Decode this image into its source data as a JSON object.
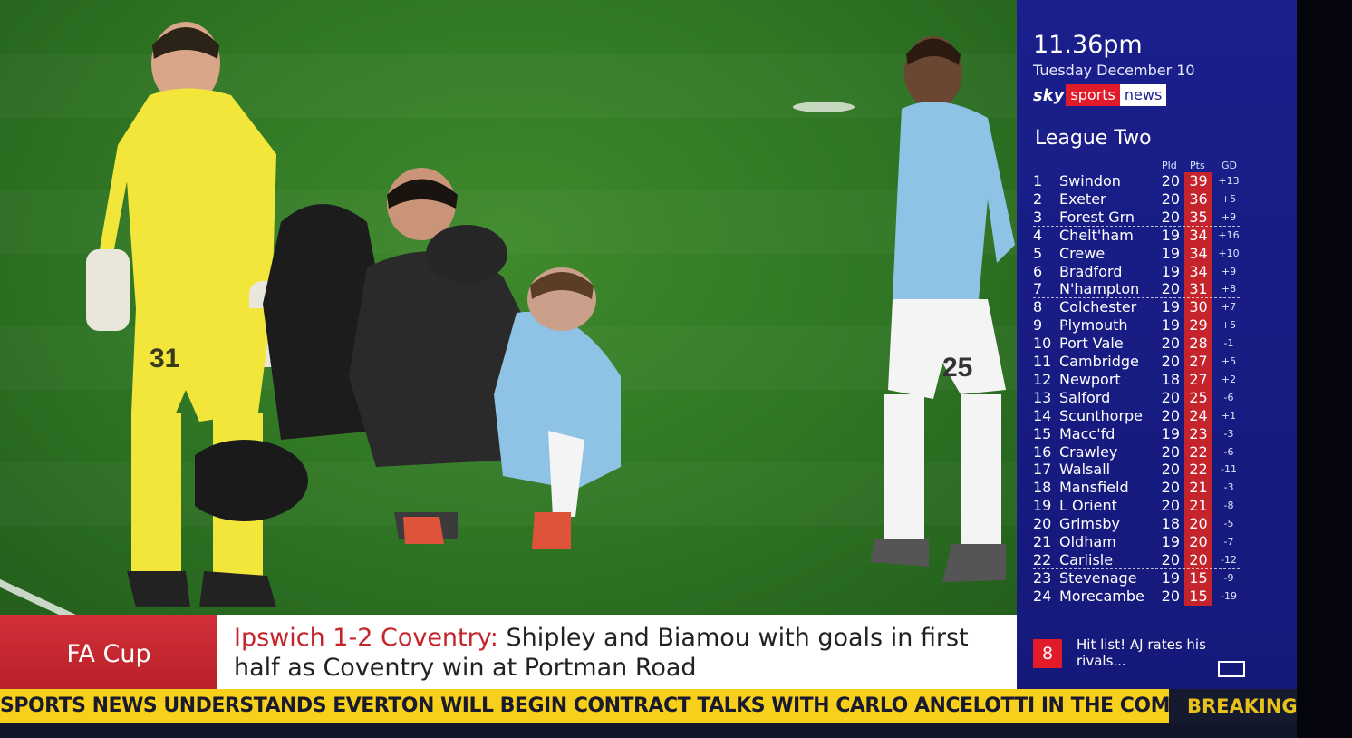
{
  "panel": {
    "time": "11.36pm",
    "date": "Tuesday December 10",
    "logo": {
      "sky": "sky",
      "sports": "sports",
      "news": "news"
    },
    "league_title": "League Two",
    "columns": {
      "pld": "Pld",
      "pts": "Pts",
      "gd": "GD"
    },
    "table": [
      {
        "pos": "1",
        "team": "Swindon",
        "pld": "20",
        "pts": "39",
        "gd": "+13"
      },
      {
        "pos": "2",
        "team": "Exeter",
        "pld": "20",
        "pts": "36",
        "gd": "+5"
      },
      {
        "pos": "3",
        "team": "Forest Grn",
        "pld": "20",
        "pts": "35",
        "gd": "+9"
      },
      {
        "pos": "4",
        "team": "Chelt'ham",
        "pld": "19",
        "pts": "34",
        "gd": "+16"
      },
      {
        "pos": "5",
        "team": "Crewe",
        "pld": "19",
        "pts": "34",
        "gd": "+10"
      },
      {
        "pos": "6",
        "team": "Bradford",
        "pld": "19",
        "pts": "34",
        "gd": "+9"
      },
      {
        "pos": "7",
        "team": "N'hampton",
        "pld": "20",
        "pts": "31",
        "gd": "+8"
      },
      {
        "pos": "8",
        "team": "Colchester",
        "pld": "19",
        "pts": "30",
        "gd": "+7"
      },
      {
        "pos": "9",
        "team": "Plymouth",
        "pld": "19",
        "pts": "29",
        "gd": "+5"
      },
      {
        "pos": "10",
        "team": "Port Vale",
        "pld": "20",
        "pts": "28",
        "gd": "-1"
      },
      {
        "pos": "11",
        "team": "Cambridge",
        "pld": "20",
        "pts": "27",
        "gd": "+5"
      },
      {
        "pos": "12",
        "team": "Newport",
        "pld": "18",
        "pts": "27",
        "gd": "+2"
      },
      {
        "pos": "13",
        "team": "Salford",
        "pld": "20",
        "pts": "25",
        "gd": "-6"
      },
      {
        "pos": "14",
        "team": "Scunthorpe",
        "pld": "20",
        "pts": "24",
        "gd": "+1"
      },
      {
        "pos": "15",
        "team": "Macc'fd",
        "pld": "19",
        "pts": "23",
        "gd": "-3"
      },
      {
        "pos": "16",
        "team": "Crawley",
        "pld": "20",
        "pts": "22",
        "gd": "-6"
      },
      {
        "pos": "17",
        "team": "Walsall",
        "pld": "20",
        "pts": "22",
        "gd": "-11"
      },
      {
        "pos": "18",
        "team": "Mansfield",
        "pld": "20",
        "pts": "21",
        "gd": "-3"
      },
      {
        "pos": "19",
        "team": "L Orient",
        "pld": "20",
        "pts": "21",
        "gd": "-8"
      },
      {
        "pos": "20",
        "team": "Grimsby",
        "pld": "18",
        "pts": "20",
        "gd": "-5"
      },
      {
        "pos": "21",
        "team": "Oldham",
        "pld": "19",
        "pts": "20",
        "gd": "-7"
      },
      {
        "pos": "22",
        "team": "Carlisle",
        "pld": "20",
        "pts": "20",
        "gd": "-12"
      },
      {
        "pos": "23",
        "team": "Stevenage",
        "pld": "19",
        "pts": "15",
        "gd": "-9"
      },
      {
        "pos": "24",
        "team": "Morecambe",
        "pld": "20",
        "pts": "15",
        "gd": "-19"
      }
    ],
    "promo": {
      "number": "8",
      "text": "Hit list! AJ rates his rivals..."
    }
  },
  "lower_third": {
    "category": "FA Cup",
    "headline_highlight": "Ipswich 1-2 Coventry:",
    "headline_rest": "Shipley and Biamou with goals in first half as Coventry win at Portman Road"
  },
  "ticker": {
    "text": "SPORTS NEWS UNDERSTANDS EVERTON WILL BEGIN CONTRACT TALKS WITH CARLO ANCELOTTI IN THE COMING DAYS",
    "breaking": "BREAKING"
  },
  "players": {
    "goalkeeper_number": "31",
    "outfield_number": "25"
  },
  "colors": {
    "panel_blue": "#1a1f8c",
    "sky_red": "#e21b2a",
    "ticker_yellow": "#f7d01c",
    "pitch_green": "#2f7524"
  }
}
